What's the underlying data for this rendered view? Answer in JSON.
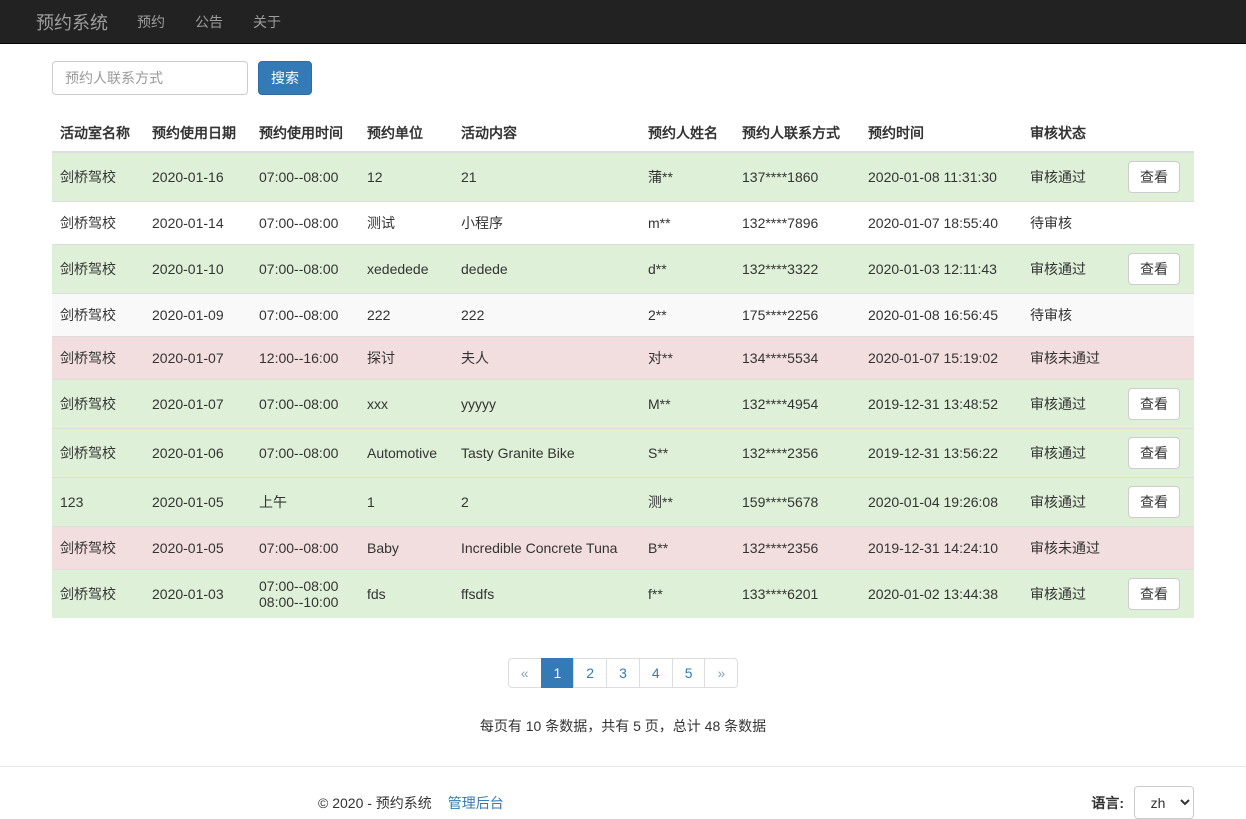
{
  "navbar": {
    "brand": "预约系统",
    "items": [
      {
        "label": "预约"
      },
      {
        "label": "公告"
      },
      {
        "label": "关于"
      }
    ]
  },
  "search": {
    "placeholder": "预约人联系方式",
    "button_label": "搜索"
  },
  "table": {
    "view_label": "查看",
    "headers": [
      "活动室名称",
      "预约使用日期",
      "预约使用时间",
      "预约单位",
      "活动内容",
      "预约人姓名",
      "预约人联系方式",
      "预约时间",
      "审核状态"
    ],
    "rows": [
      {
        "room": "剑桥驾校",
        "date": "2020-01-16",
        "time": "07:00--08:00",
        "unit": "12",
        "content": "21",
        "name": "蒲**",
        "phone": "137****1860",
        "booked_at": "2020-01-08 11:31:30",
        "status": "审核通过"
      },
      {
        "room": "剑桥驾校",
        "date": "2020-01-14",
        "time": "07:00--08:00",
        "unit": "测试",
        "content": "小程序",
        "name": "m**",
        "phone": "132****7896",
        "booked_at": "2020-01-07 18:55:40",
        "status": "待审核"
      },
      {
        "room": "剑桥驾校",
        "date": "2020-01-10",
        "time": "07:00--08:00",
        "unit": "xededede",
        "content": "dedede",
        "name": "d**",
        "phone": "132****3322",
        "booked_at": "2020-01-03 12:11:43",
        "status": "审核通过"
      },
      {
        "room": "剑桥驾校",
        "date": "2020-01-09",
        "time": "07:00--08:00",
        "unit": "222",
        "content": "222",
        "name": "2**",
        "phone": "175****2256",
        "booked_at": "2020-01-08 16:56:45",
        "status": "待审核"
      },
      {
        "room": "剑桥驾校",
        "date": "2020-01-07",
        "time": "12:00--16:00",
        "unit": "探讨",
        "content": "夫人",
        "name": "对**",
        "phone": "134****5534",
        "booked_at": "2020-01-07 15:19:02",
        "status": "审核未通过"
      },
      {
        "room": "剑桥驾校",
        "date": "2020-01-07",
        "time": "07:00--08:00",
        "unit": "xxx",
        "content": "yyyyy",
        "name": "M**",
        "phone": "132****4954",
        "booked_at": "2019-12-31 13:48:52",
        "status": "审核通过"
      },
      {
        "room": "剑桥驾校",
        "date": "2020-01-06",
        "time": "07:00--08:00",
        "unit": "Automotive",
        "content": "Tasty Granite Bike",
        "name": "S**",
        "phone": "132****2356",
        "booked_at": "2019-12-31 13:56:22",
        "status": "审核通过"
      },
      {
        "room": "123",
        "date": "2020-01-05",
        "time": "上午",
        "unit": "1",
        "content": "2",
        "name": "测**",
        "phone": "159****5678",
        "booked_at": "2020-01-04 19:26:08",
        "status": "审核通过"
      },
      {
        "room": "剑桥驾校",
        "date": "2020-01-05",
        "time": "07:00--08:00",
        "unit": "Baby",
        "content": "Incredible Concrete Tuna",
        "name": "B**",
        "phone": "132****2356",
        "booked_at": "2019-12-31 14:24:10",
        "status": "审核未通过"
      },
      {
        "room": "剑桥驾校",
        "date": "2020-01-03",
        "time": "07:00--08:00",
        "time2": "08:00--10:00",
        "unit": "fds",
        "content": "ffsdfs",
        "name": "f**",
        "phone": "133****6201",
        "booked_at": "2020-01-02 13:44:38",
        "status": "审核通过"
      }
    ]
  },
  "pagination": {
    "prev": "«",
    "pages": [
      "1",
      "2",
      "3",
      "4",
      "5"
    ],
    "active_page": "1",
    "next": "»"
  },
  "summary_text": "每页有 10 条数据，共有 5 页，总计 48 条数据",
  "footer": {
    "copyright": "© 2020 - 预约系统",
    "admin_link": "管理后台",
    "language_label": "语言:",
    "language_value": "zh"
  },
  "colors": {
    "navbar_bg": "#222222",
    "primary": "#337ab7",
    "success_row_bg": "#dff0d8",
    "danger_row_bg": "#f2dede",
    "stripe_row_bg": "#f9f9f9"
  }
}
